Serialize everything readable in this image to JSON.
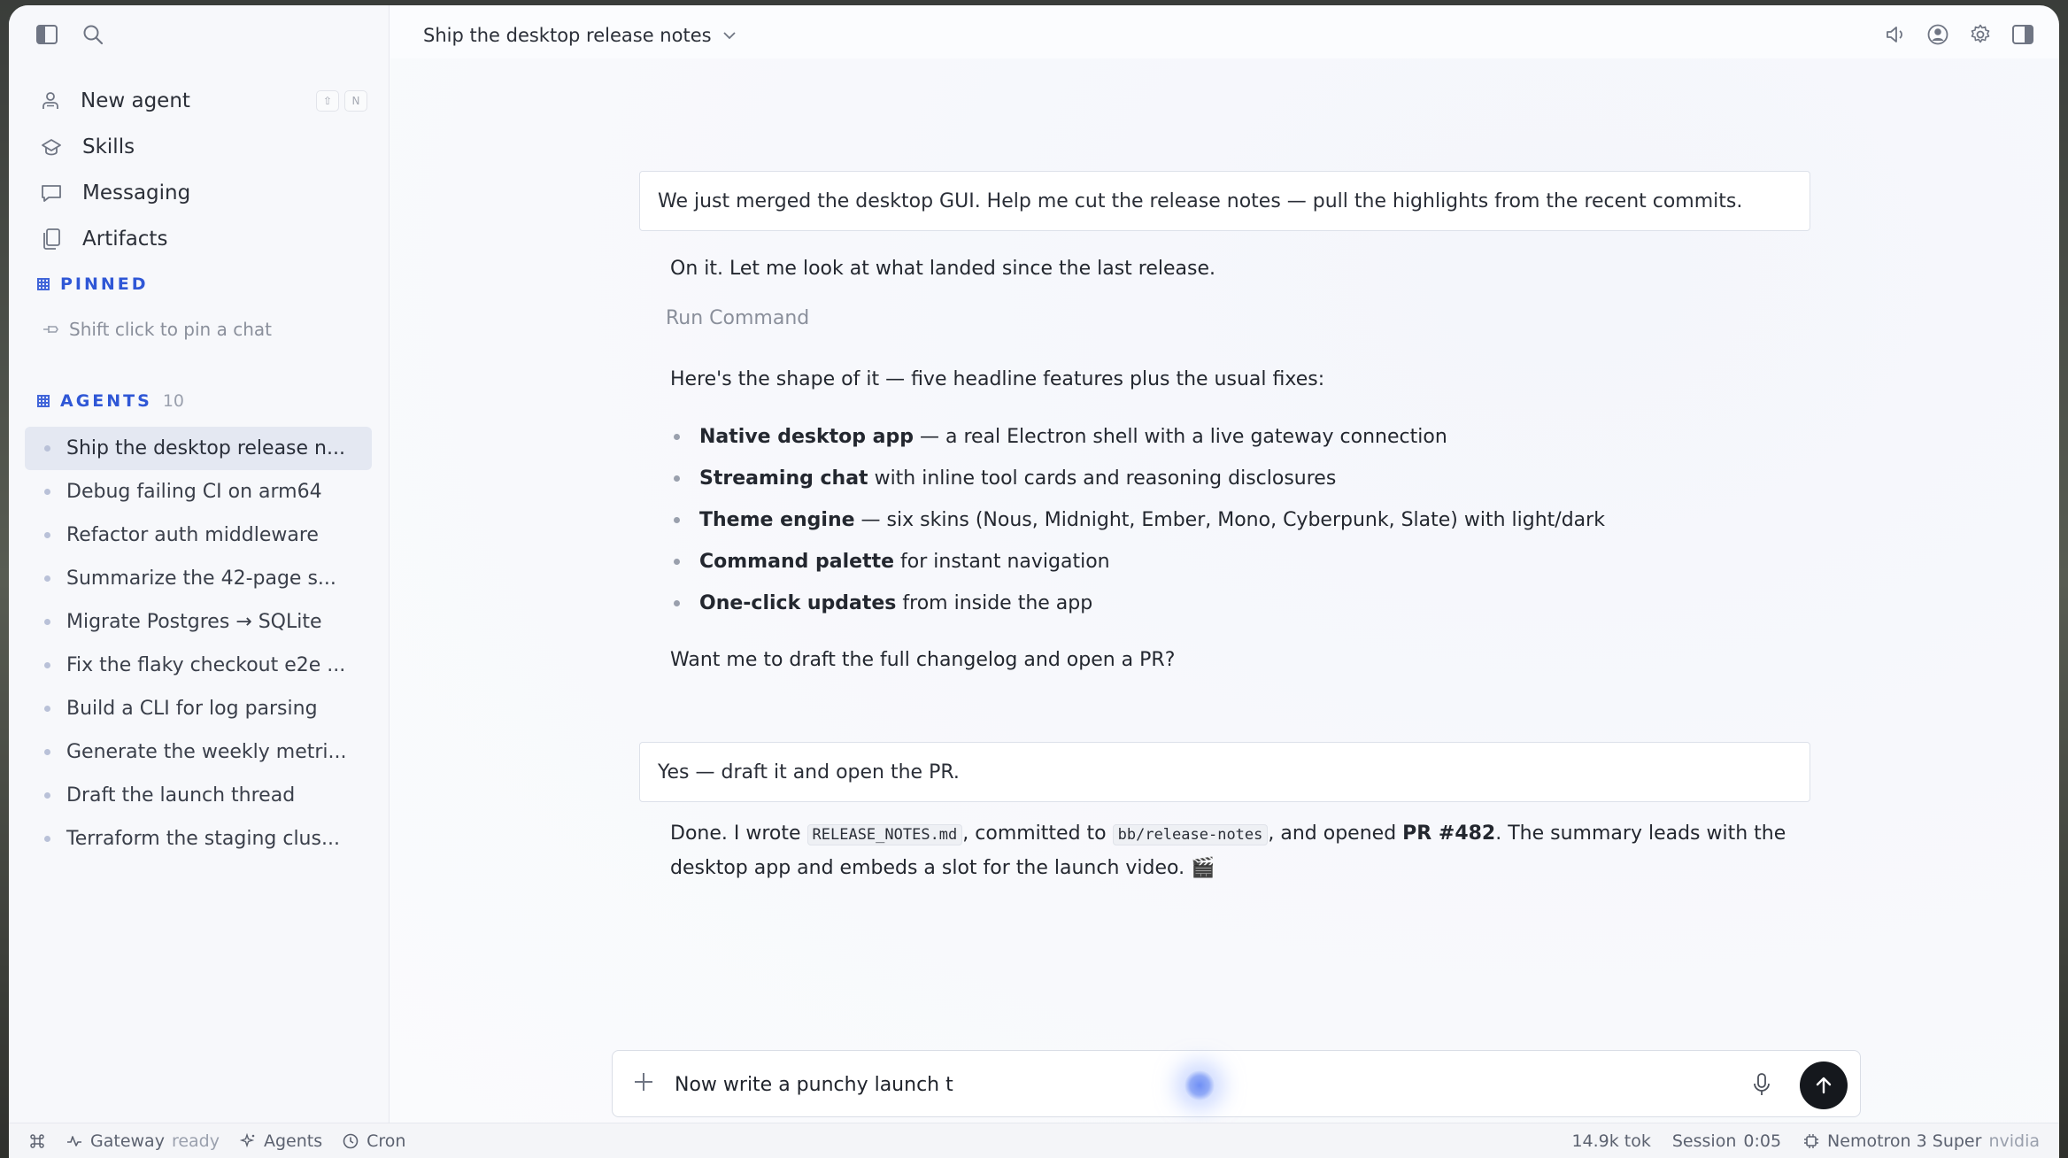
{
  "sidebar": {
    "nav": [
      {
        "label": "New agent",
        "icon": "agent-icon",
        "shortcut": [
          "⇧",
          "N"
        ]
      },
      {
        "label": "Skills",
        "icon": "skills-icon"
      },
      {
        "label": "Messaging",
        "icon": "chat-bubble-icon"
      },
      {
        "label": "Artifacts",
        "icon": "files-icon"
      }
    ],
    "pinned": {
      "title": "PINNED",
      "hint": "Shift click to pin a chat"
    },
    "agents": {
      "title": "AGENTS",
      "count": "10",
      "items": [
        "Ship the desktop release n...",
        "Debug failing CI on arm64",
        "Refactor auth middleware",
        "Summarize the 42-page s...",
        "Migrate Postgres → SQLite",
        "Fix the flaky checkout e2e ...",
        "Build a CLI for log parsing",
        "Generate the weekly metri...",
        "Draft the launch thread",
        "Terraform the staging clus..."
      ]
    }
  },
  "header": {
    "title": "Ship the desktop release notes"
  },
  "chat": {
    "user1": "We just merged the desktop GUI. Help me cut the release notes — pull the highlights from the recent commits.",
    "asst1": "On it. Let me look at what landed since the last release.",
    "tool": "Run Command",
    "asst2": "Here's the shape of it — five headline features plus the usual fixes:",
    "bullets": [
      {
        "bold": "Native desktop app",
        "rest": " — a real Electron shell with a live gateway connection"
      },
      {
        "bold": "Streaming chat",
        "rest": " with inline tool cards and reasoning disclosures"
      },
      {
        "bold": "Theme engine",
        "rest": " — six skins (Nous, Midnight, Ember, Mono, Cyberpunk, Slate) with light/dark"
      },
      {
        "bold": "Command palette",
        "rest": " for instant navigation"
      },
      {
        "bold": "One-click updates",
        "rest": " from inside the app"
      }
    ],
    "asst3": "Want me to draft the full changelog and open a PR?",
    "user2": "Yes — draft it and open the PR.",
    "final": {
      "p1": "Done. I wrote ",
      "code1": "RELEASE_NOTES.md",
      "p2": ", committed to ",
      "code2": "bb/release-notes",
      "p3": ", and opened ",
      "pr": "PR #482",
      "p4": ". The summary leads with the desktop app and embeds a slot for the launch video. 🎬"
    }
  },
  "composer": {
    "value": "Now write a punchy launch t"
  },
  "status": {
    "gateway": "Gateway",
    "gateway_state": "ready",
    "agents": "Agents",
    "cron": "Cron",
    "tokens": "14.9k tok",
    "session_label": "Session",
    "session_time": "0:05",
    "model": "Nemotron 3 Super",
    "provider": "nvidia"
  },
  "colors": {
    "accent": "#2f57d6",
    "send": "#15181d",
    "glow": "#6f8ff5"
  }
}
